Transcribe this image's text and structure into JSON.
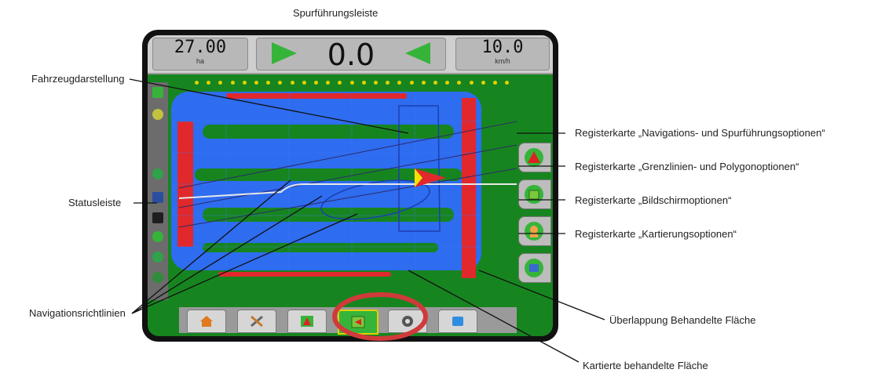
{
  "callouts": {
    "top": "Spurführungsleiste",
    "vehicle": "Fahrzeugdarstellung",
    "statusbar": "Statusleiste",
    "guidelines": "Navigationsrichtlinien",
    "tab_nav": "Registerkarte „Navigations- und Spurführungsoptionen“",
    "tab_boundary": "Registerkarte „Grenzlinien- und Polygonoptionen“",
    "tab_screen": "Registerkarte „Bildschirmoptionen“",
    "tab_mapping": "Registerkarte „Kartierungsoptionen“",
    "overlap": "Überlappung Behandelte Fläche",
    "mapped": "Kartierte behandelte Fläche"
  },
  "topbar": {
    "area_value": "27.00",
    "area_unit": "ha",
    "offline_value": "0.0",
    "speed_value": "10.0",
    "speed_unit": "km/h"
  },
  "lightbar": {
    "led_count": 27
  },
  "colors": {
    "field": "#17851f",
    "applied": "#2e6cf0",
    "overlap": "#e0282d",
    "guidance": "#2bb52b",
    "lightbar_led": "#e2d100",
    "highlight_ring": "#d03a3a"
  },
  "icons": {
    "right_tabs": [
      "guidance-options-icon",
      "boundary-options-icon",
      "screen-options-icon",
      "mapping-options-icon"
    ],
    "bottom_tabs": [
      "home-icon",
      "tools-icon",
      "vehicle-view-icon",
      "field-view-icon",
      "camera-icon",
      "rate-control-icon"
    ]
  }
}
